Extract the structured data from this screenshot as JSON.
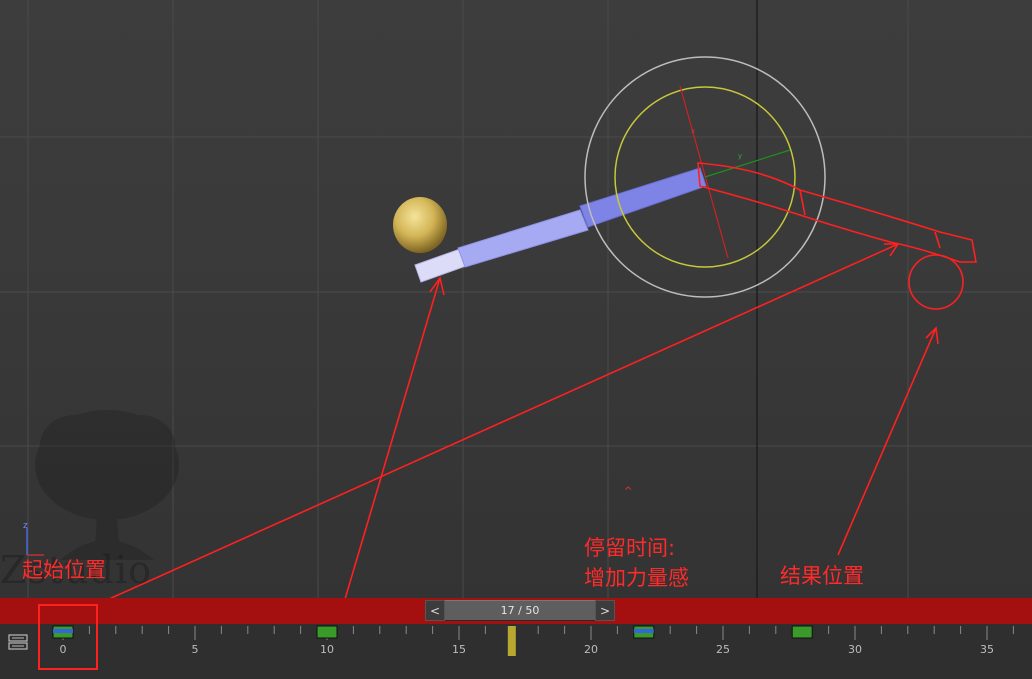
{
  "annotations": {
    "start": "起始位置",
    "pause_line1": "停留时间:",
    "pause_line2": "增加力量感",
    "result": "结果位置"
  },
  "watermark": {
    "text": "Zstudio"
  },
  "timeslider": {
    "prev": "<",
    "frame_label": "17 / 50",
    "next": ">",
    "current_frame": 17,
    "total_frames": 50
  },
  "trackbar": {
    "tick_labels": [
      "0",
      "5",
      "10",
      "15",
      "20",
      "25",
      "30",
      "35"
    ],
    "keyframes": [
      0,
      10,
      22,
      28
    ]
  },
  "axis_gizmo": {
    "z_label": "z"
  },
  "colors": {
    "annotation": "#ff2a2a",
    "timebar": "#a40f0f",
    "ball": "#d8c060",
    "bone": "#8a8ef0",
    "rotate_gizmo_outer": "#c8c8c8",
    "rotate_gizmo_inner": "#c8c83a",
    "keyframe": "#3a9a2a",
    "current_frame_marker": "#b8a830"
  }
}
